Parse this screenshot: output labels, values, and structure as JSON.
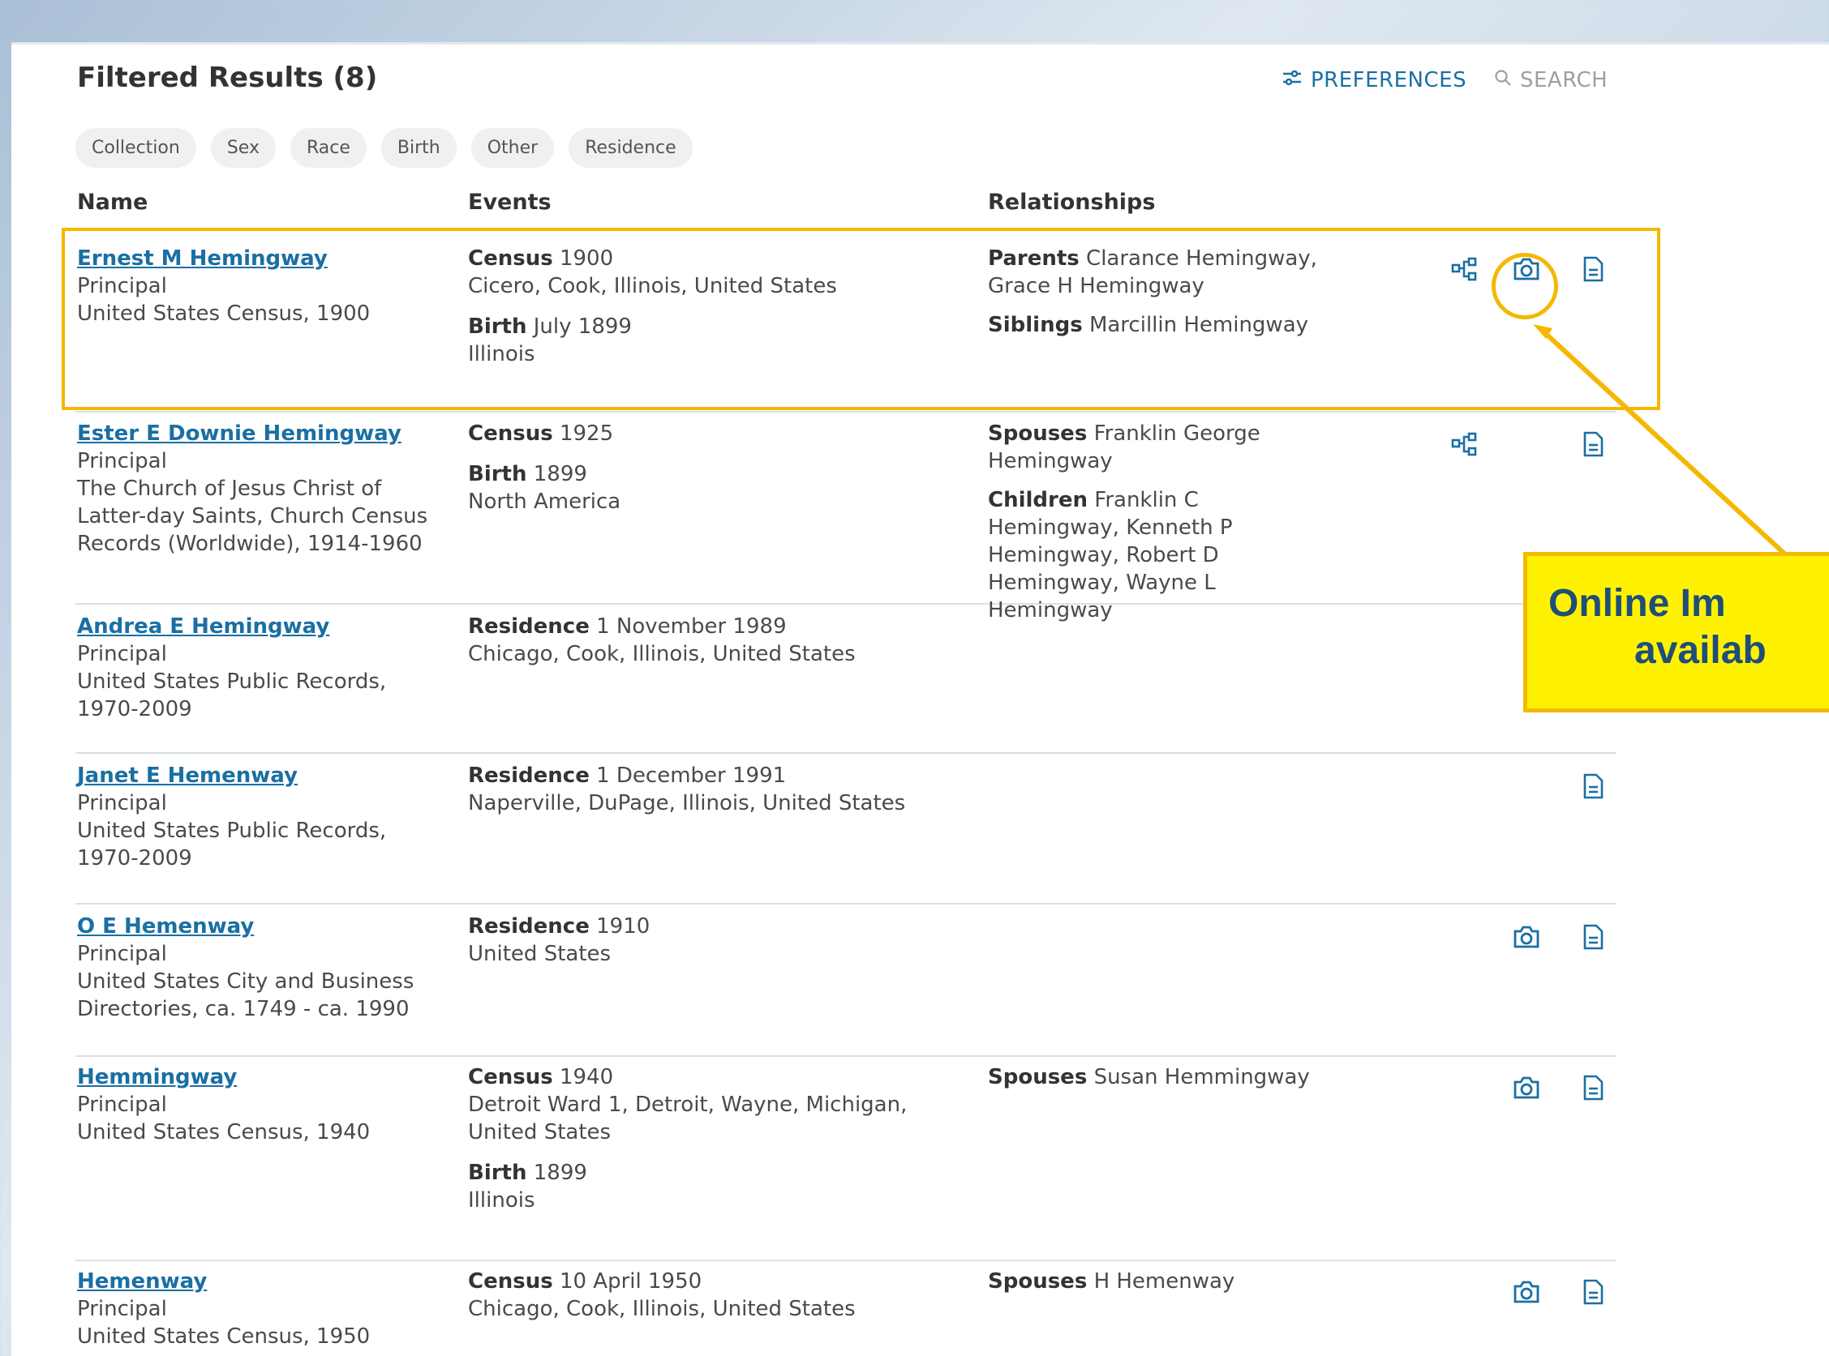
{
  "header": {
    "title": "Filtered Results (8)",
    "preferences_label": "PREFERENCES",
    "search_label": "SEARCH"
  },
  "filters": [
    "Collection",
    "Sex",
    "Race",
    "Birth",
    "Other",
    "Residence"
  ],
  "columns": {
    "name": "Name",
    "events": "Events",
    "relationships": "Relationships"
  },
  "rows": [
    {
      "name": "Ernest M Hemingway",
      "role": "Principal",
      "collection": "United States Census, 1900",
      "events": [
        {
          "label": "Census",
          "date": "1900",
          "place": "Cicero, Cook, Illinois, United States"
        },
        {
          "label": "Birth",
          "date": "July 1899",
          "place": "Illinois"
        }
      ],
      "relationships": [
        {
          "label": "Parents",
          "value": "Clarance Hemingway, Grace H Hemingway"
        },
        {
          "label": "Siblings",
          "value": "Marcillin Hemingway"
        }
      ]
    },
    {
      "name": "Ester E Downie Hemingway",
      "role": "Principal",
      "collection": "The Church of Jesus Christ of Latter-day Saints, Church Census Records (Worldwide), 1914-1960",
      "events": [
        {
          "label": "Census",
          "date": "1925",
          "place": ""
        },
        {
          "label": "Birth",
          "date": "1899",
          "place": "North America"
        }
      ],
      "relationships": [
        {
          "label": "Spouses",
          "value": "Franklin George Hemingway"
        },
        {
          "label": "Children",
          "value": "Franklin C Hemingway, Kenneth P Hemingway, Robert D Hemingway, Wayne L Hemingway"
        }
      ]
    },
    {
      "name": "Andrea E Hemingway",
      "role": "Principal",
      "collection": "United States Public Records, 1970-2009",
      "events": [
        {
          "label": "Residence",
          "date": "1 November 1989",
          "place": "Chicago, Cook, Illinois, United States"
        }
      ],
      "relationships": []
    },
    {
      "name": "Janet E Hemenway",
      "role": "Principal",
      "collection": "United States Public Records, 1970-2009",
      "events": [
        {
          "label": "Residence",
          "date": "1 December 1991",
          "place": "Naperville, DuPage, Illinois, United States"
        }
      ],
      "relationships": []
    },
    {
      "name": "O E Hemenway",
      "role": "Principal",
      "collection": "United States City and Business Directories, ca. 1749 - ca. 1990",
      "events": [
        {
          "label": "Residence",
          "date": "1910",
          "place": "United States"
        }
      ],
      "relationships": []
    },
    {
      "name": "Hemmingway",
      "role": "Principal",
      "collection": "United States Census, 1940",
      "events": [
        {
          "label": "Census",
          "date": "1940",
          "place": "Detroit Ward 1, Detroit, Wayne, Michigan, United States"
        },
        {
          "label": "Birth",
          "date": "1899",
          "place": "Illinois"
        }
      ],
      "relationships": [
        {
          "label": "Spouses",
          "value": "Susan Hemmingway"
        }
      ]
    },
    {
      "name": "Hemenway",
      "role": "Principal",
      "collection": "United States Census, 1950",
      "events": [
        {
          "label": "Census",
          "date": "10 April 1950",
          "place": "Chicago, Cook, Illinois, United States"
        }
      ],
      "relationships": [
        {
          "label": "Spouses",
          "value": "H Hemenway"
        }
      ]
    }
  ],
  "callout": {
    "line1": "Online Im",
    "line2": "availab"
  },
  "colors": {
    "accent": "#1a6fa3",
    "highlight": "#f5b800",
    "callout_bg": "#fff200"
  }
}
